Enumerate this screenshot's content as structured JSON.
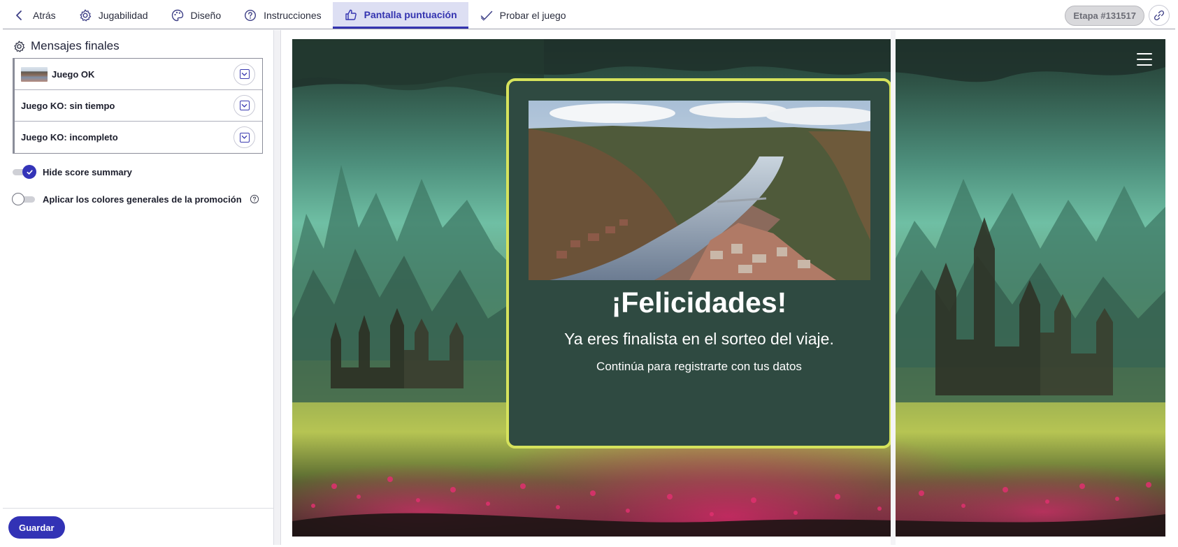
{
  "nav": {
    "back": "Atrás",
    "tabs": [
      {
        "label": "Jugabilidad",
        "icon": "gear-icon"
      },
      {
        "label": "Diseño",
        "icon": "palette-icon"
      },
      {
        "label": "Instrucciones",
        "icon": "help-circle-icon"
      },
      {
        "label": "Pantalla puntuación",
        "icon": "thumbs-up-icon",
        "active": true
      },
      {
        "label": "Probar el juego",
        "icon": "check-icon"
      }
    ],
    "stage": "Etapa #131517",
    "link_icon": "link-icon"
  },
  "left_panel": {
    "section_title": "Mensajes finales",
    "messages": [
      {
        "label": "Juego OK",
        "has_thumbnail": true
      },
      {
        "label": "Juego KO: sin tiempo",
        "has_thumbnail": false
      },
      {
        "label": "Juego KO: incompleto",
        "has_thumbnail": false
      }
    ],
    "options": [
      {
        "label": "Hide score summary",
        "enabled": true
      },
      {
        "label": "Aplicar los colores generales de la promoción",
        "enabled": false,
        "has_help": true
      }
    ],
    "save_label": "Guardar"
  },
  "preview": {
    "title": "¡Felicidades!",
    "message": "Ya eres finalista en el sorteo del viaje.",
    "submessage": "Continúa para registrarte con tus datos"
  },
  "colors": {
    "accent": "#3434b0",
    "active_tab_bg": "#dddff3",
    "card_bg": "#2f4a41",
    "card_border": "#d6e35c"
  }
}
